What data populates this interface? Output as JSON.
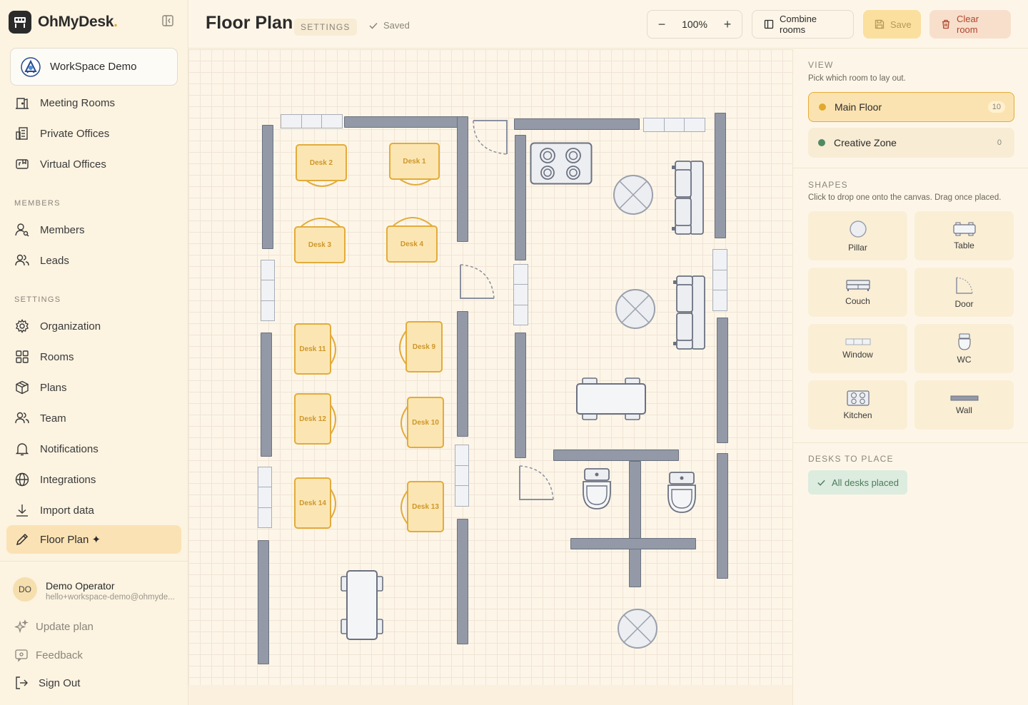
{
  "brand": {
    "name": "OhMyDesk",
    "dot": "."
  },
  "workspace": {
    "name": "WorkSpace Demo"
  },
  "nav_top": [
    {
      "label": "Meeting Rooms",
      "icon": "meeting-rooms-icon"
    },
    {
      "label": "Private Offices",
      "icon": "private-offices-icon"
    },
    {
      "label": "Virtual Offices",
      "icon": "virtual-offices-icon"
    }
  ],
  "members_section": {
    "label": "MEMBERS",
    "items": [
      {
        "label": "Members"
      },
      {
        "label": "Leads"
      }
    ]
  },
  "settings_section": {
    "label": "SETTINGS",
    "items": [
      {
        "label": "Organization"
      },
      {
        "label": "Rooms"
      },
      {
        "label": "Plans"
      },
      {
        "label": "Team"
      },
      {
        "label": "Notifications"
      },
      {
        "label": "Integrations"
      },
      {
        "label": "Import data"
      },
      {
        "label": "Floor Plan ✦"
      }
    ]
  },
  "user": {
    "initials": "DO",
    "name": "Demo Operator",
    "email": "hello+workspace-demo@ohmyde..."
  },
  "bottom": {
    "update_plan": "Update plan",
    "feedback": "Feedback",
    "sign_out": "Sign Out"
  },
  "header": {
    "title": "Floor Plan",
    "badge": "SETTINGS",
    "status": "Saved",
    "zoom": "100%",
    "combine": "Combine rooms",
    "save": "Save",
    "clear": "Clear room"
  },
  "canvas": {
    "desks": [
      "Desk 2",
      "Desk 1",
      "Desk 3",
      "Desk 4",
      "Desk 11",
      "Desk 9",
      "Desk 12",
      "Desk 10",
      "Desk 14",
      "Desk 13"
    ]
  },
  "panel": {
    "view_title": "VIEW",
    "view_sub": "Pick which room to lay out.",
    "rooms": [
      {
        "name": "Main Floor",
        "count": "10",
        "color": "#e0a92c"
      },
      {
        "name": "Creative Zone",
        "count": "0",
        "color": "#4e8a63"
      }
    ],
    "shapes_title": "SHAPES",
    "shapes_sub": "Click to drop one onto the canvas. Drag once placed.",
    "shapes": [
      "Pillar",
      "Table",
      "Couch",
      "Door",
      "Window",
      "WC",
      "Kitchen",
      "Wall"
    ],
    "desks_title": "DESKS TO PLACE",
    "all_placed": "All desks placed"
  },
  "colors": {
    "accent": "#e0a92c",
    "active_bg": "#fbe2b4",
    "danger": "#b0452c",
    "success": "#4e8a63"
  }
}
